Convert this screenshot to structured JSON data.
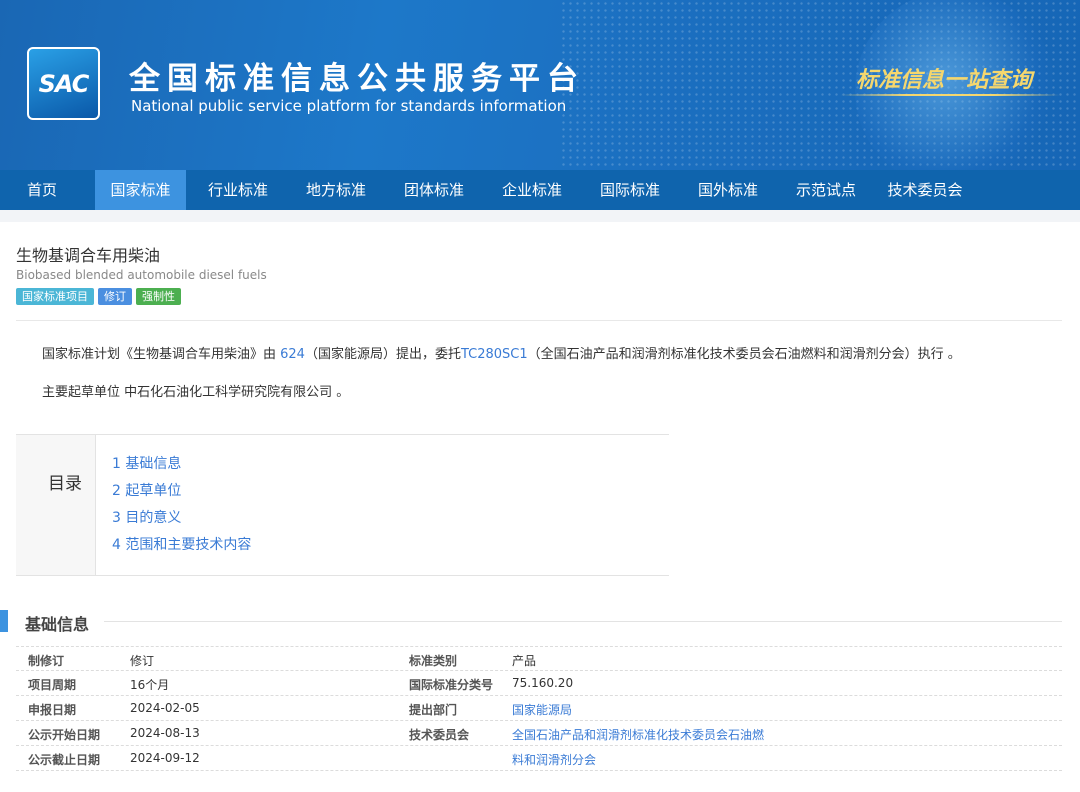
{
  "header": {
    "logo_text": "SAC",
    "title_cn": "全国标准信息公共服务平台",
    "title_en": "National public service platform  for standards information",
    "slogan": "标准信息一站查询"
  },
  "nav": {
    "items": [
      "首页",
      "国家标准",
      "行业标准",
      "地方标准",
      "团体标准",
      "企业标准",
      "国际标准",
      "国外标准",
      "示范试点",
      "技术委员会"
    ],
    "active": "国家标准"
  },
  "project": {
    "title": "生物基调合车用柴油",
    "title_en": "Biobased blended automobile diesel fuels",
    "tags": [
      "国家标准项目",
      "修订",
      "强制性"
    ]
  },
  "summary": {
    "p1_a": "国家标准计划《生物基调合车用柴油》由 ",
    "p1_link1": "624",
    "p1_b": "（国家能源局）提出，委托",
    "p1_link2": "TC280SC1",
    "p1_c": "（全国石油产品和润滑剂标准化技术委员会石油燃料和润滑剂分会）执行 。",
    "p2": "主要起草单位 中石化石油化工科学研究院有限公司 。"
  },
  "toc": {
    "label": "目录",
    "items": [
      "1  基础信息",
      "2  起草单位",
      "3  目的意义",
      "4  范围和主要技术内容"
    ]
  },
  "basic_info": {
    "title": "基础信息",
    "rows": [
      {
        "l1": "制修订",
        "v1": "修订",
        "l2": "标准类别",
        "v2": "产品"
      },
      {
        "l1": "项目周期",
        "v1": "16个月",
        "l2": "国际标准分类号",
        "v2": "75.160.20"
      },
      {
        "l1": "申报日期",
        "v1": "2024-02-05",
        "l2": "提出部门",
        "v2": "国家能源局"
      },
      {
        "l1": "公示开始日期",
        "v1": "2024-08-13",
        "l2": "技术委员会",
        "v2": "全国石油产品和润滑剂标准化技术委员会石油燃"
      },
      {
        "l1": "公示截止日期",
        "v1": "2024-09-12",
        "l2": "",
        "v2": "料和润滑剂分会"
      }
    ]
  }
}
